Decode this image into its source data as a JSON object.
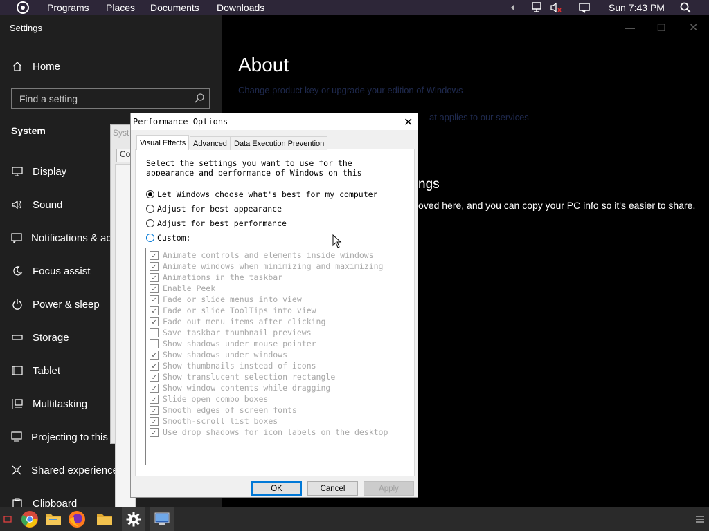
{
  "top_panel": {
    "menus": [
      "Programs",
      "Places",
      "Documents",
      "Downloads"
    ],
    "clock": "Sun 7:43 PM"
  },
  "settings": {
    "window_title": "Settings",
    "home_label": "Home",
    "search_placeholder": "Find a setting",
    "section_heading": "System",
    "nav_items": [
      {
        "label": "Display",
        "icon": "monitor-icon"
      },
      {
        "label": "Sound",
        "icon": "speaker-icon"
      },
      {
        "label": "Notifications & actions",
        "icon": "notification-icon"
      },
      {
        "label": "Focus assist",
        "icon": "moon-icon"
      },
      {
        "label": "Power & sleep",
        "icon": "power-icon"
      },
      {
        "label": "Storage",
        "icon": "storage-icon"
      },
      {
        "label": "Tablet",
        "icon": "tablet-icon"
      },
      {
        "label": "Multitasking",
        "icon": "multitasking-icon"
      },
      {
        "label": "Projecting to this PC",
        "icon": "projecting-icon"
      },
      {
        "label": "Shared experiences",
        "icon": "shared-icon"
      },
      {
        "label": "Clipboard",
        "icon": "clipboard-icon"
      }
    ],
    "main": {
      "title": "About",
      "product_key_link": "Change product key or upgrade your edition of Windows",
      "services_text": "at applies to our services",
      "related_heading": "ngs",
      "copy_info_text": "oved here, and you can copy your PC info so it's easier to share."
    }
  },
  "system_properties": {
    "title_fragment": "Syst",
    "tab_fragment": "Co"
  },
  "performance_dialog": {
    "title": "Performance Options",
    "tabs": [
      "Visual Effects",
      "Advanced",
      "Data Execution Prevention"
    ],
    "intro": "Select the settings you want to use for the appearance and performance of Windows on this",
    "options": [
      {
        "label": "Let Windows choose what's best for my computer",
        "checked": true
      },
      {
        "label": "Adjust for best appearance",
        "checked": false
      },
      {
        "label": "Adjust for best performance",
        "checked": false
      },
      {
        "label": "Custom:",
        "checked": false
      }
    ],
    "effects": [
      {
        "label": "Animate controls and elements inside windows",
        "checked": true
      },
      {
        "label": "Animate windows when minimizing and maximizing",
        "checked": true
      },
      {
        "label": "Animations in the taskbar",
        "checked": true
      },
      {
        "label": "Enable Peek",
        "checked": true
      },
      {
        "label": "Fade or slide menus into view",
        "checked": true
      },
      {
        "label": "Fade or slide ToolTips into view",
        "checked": true
      },
      {
        "label": "Fade out menu items after clicking",
        "checked": true
      },
      {
        "label": "Save taskbar thumbnail previews",
        "checked": false
      },
      {
        "label": "Show shadows under mouse pointer",
        "checked": false
      },
      {
        "label": "Show shadows under windows",
        "checked": true
      },
      {
        "label": "Show thumbnails instead of icons",
        "checked": true
      },
      {
        "label": "Show translucent selection rectangle",
        "checked": true
      },
      {
        "label": "Show window contents while dragging",
        "checked": true
      },
      {
        "label": "Slide open combo boxes",
        "checked": true
      },
      {
        "label": "Smooth edges of screen fonts",
        "checked": true
      },
      {
        "label": "Smooth-scroll list boxes",
        "checked": true
      },
      {
        "label": "Use drop shadows for icon labels on the desktop",
        "checked": true
      }
    ],
    "buttons": {
      "ok": "OK",
      "cancel": "Cancel",
      "apply": "Apply"
    }
  },
  "taskbar": {
    "apps": [
      "chromium-icon",
      "file-manager-icon",
      "firefox-icon",
      "folder-icon",
      "settings-gear-icon",
      "system-window-icon"
    ]
  },
  "colors": {
    "top_panel": "#2d2638",
    "settings_nav": "#1f1f1f",
    "accent": "#0078d7"
  }
}
